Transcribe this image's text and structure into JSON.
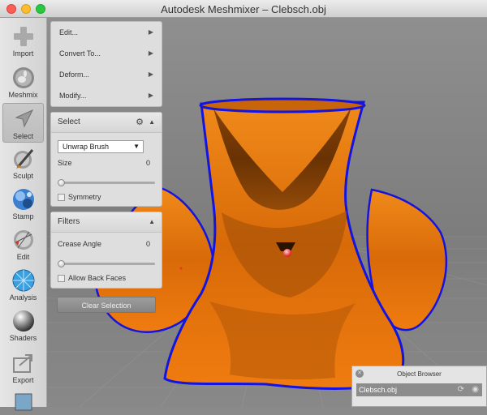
{
  "window": {
    "title": "Autodesk Meshmixer – Clebsch.obj",
    "traffic_colors": {
      "close": "#fd5f57",
      "minimize": "#febc2e",
      "maximize": "#28c840"
    }
  },
  "toolbar": {
    "items": [
      {
        "label": "Import",
        "icon": "plus-icon"
      },
      {
        "label": "Meshmix",
        "icon": "bunny-sphere-icon"
      },
      {
        "label": "Select",
        "icon": "cursor-arrow-icon",
        "active": true
      },
      {
        "label": "Sculpt",
        "icon": "brush-icon"
      },
      {
        "label": "Stamp",
        "icon": "stamp-sphere-icon"
      },
      {
        "label": "Edit",
        "icon": "edit-mesh-icon"
      },
      {
        "label": "Analysis",
        "icon": "analysis-sphere-icon"
      },
      {
        "label": "Shaders",
        "icon": "shader-sphere-icon"
      },
      {
        "label": "Export",
        "icon": "export-icon"
      }
    ]
  },
  "select_menu": {
    "items": [
      {
        "label": "Edit..."
      },
      {
        "label": "Convert To..."
      },
      {
        "label": "Deform..."
      },
      {
        "label": "Modify..."
      }
    ]
  },
  "select_panel": {
    "title": "Select",
    "brush": "Unwrap Brush",
    "size_label": "Size",
    "size_value": "0",
    "size_fraction": 0.0,
    "symmetry_label": "Symmetry",
    "symmetry_checked": false
  },
  "filters_panel": {
    "title": "Filters",
    "crease_label": "Crease Angle",
    "crease_value": "0",
    "crease_fraction": 0.0,
    "backfaces_label": "Allow Back Faces",
    "backfaces_checked": false
  },
  "clear_button": "Clear Selection",
  "object_browser": {
    "title": "Object Browser",
    "objects": [
      {
        "name": "Clebsch.obj",
        "selected": true
      }
    ]
  },
  "colors": {
    "mesh_orange": "#f07c10",
    "mesh_boundary": "#1414e0",
    "viewport_gray": "#8a8a8a",
    "pivot_red": "#ff5555"
  }
}
